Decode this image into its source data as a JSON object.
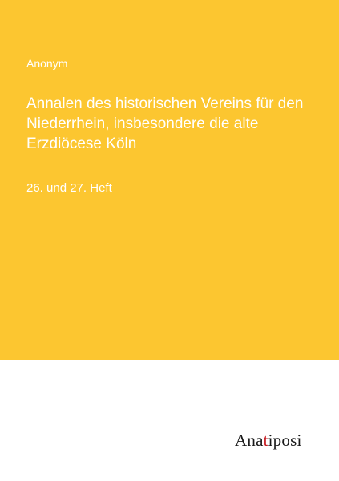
{
  "book": {
    "author": "Anonym",
    "title": "Annalen des historischen Vereins für den Niederrhein, insbesondere die alte Erzdiöcese Köln",
    "subtitle": "26. und 27. Heft"
  },
  "publisher": {
    "name": "Anatiposi",
    "logo_parts": [
      "Ana",
      "t",
      "iposi"
    ]
  },
  "colors": {
    "cover_background": "#fcc630",
    "text_on_cover": "#ffffff",
    "page_background": "#ffffff",
    "logo_text": "#1a1a1a",
    "logo_accent": "#c4161c"
  }
}
